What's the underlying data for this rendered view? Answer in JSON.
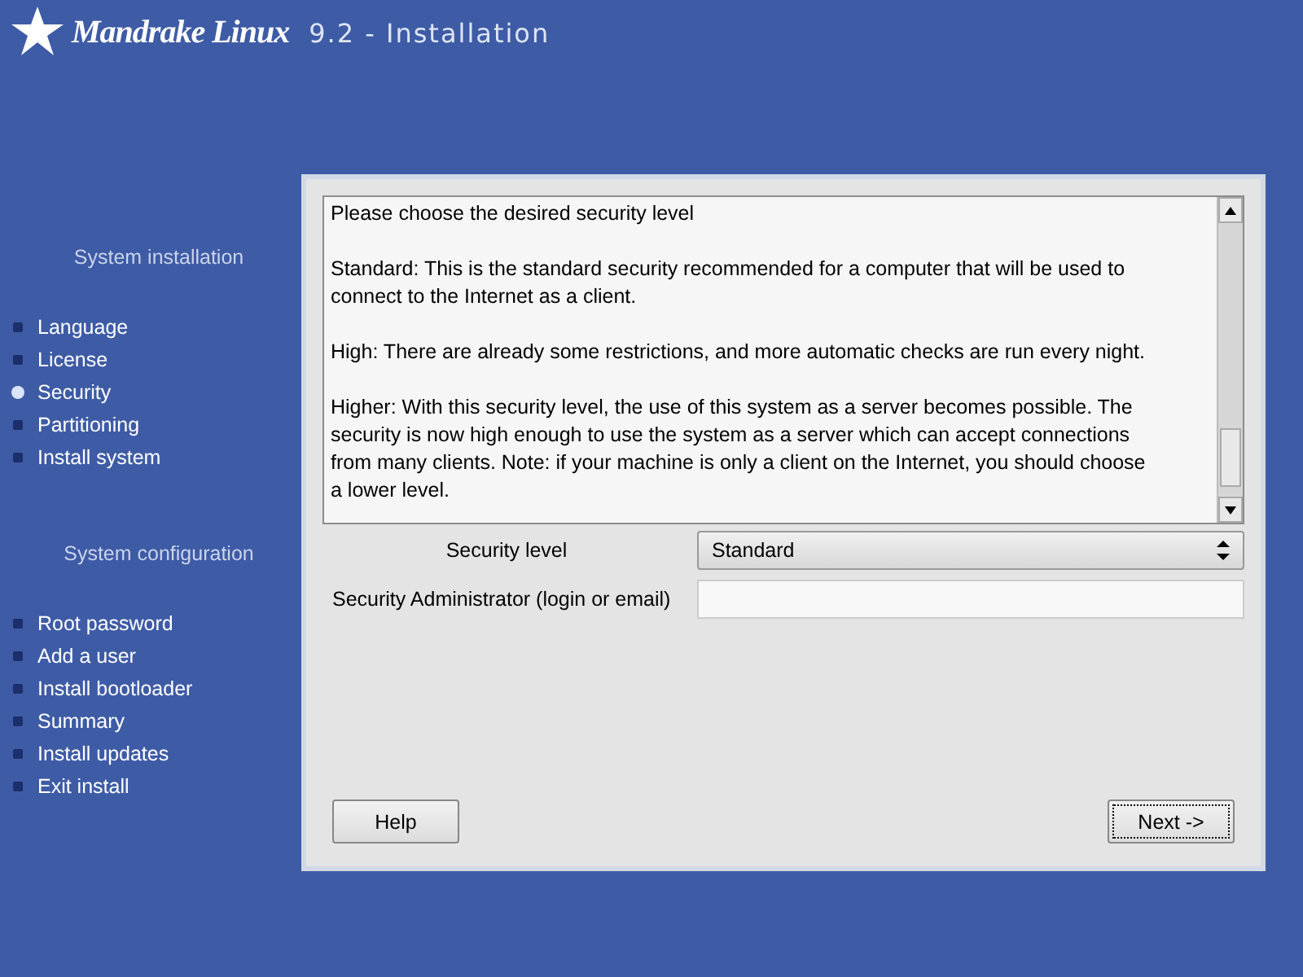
{
  "header": {
    "brand": "Mandrake Linux",
    "title": "9.2 - Installation"
  },
  "sidebar": {
    "sections": [
      {
        "heading": "System installation",
        "items": [
          {
            "label": "Language",
            "selected": false
          },
          {
            "label": "License",
            "selected": false
          },
          {
            "label": "Security",
            "selected": true
          },
          {
            "label": "Partitioning",
            "selected": false
          },
          {
            "label": "Install system",
            "selected": false
          }
        ]
      },
      {
        "heading": "System configuration",
        "items": [
          {
            "label": "Root password",
            "selected": false
          },
          {
            "label": "Add a user",
            "selected": false
          },
          {
            "label": "Install bootloader",
            "selected": false
          },
          {
            "label": "Summary",
            "selected": false
          },
          {
            "label": "Install updates",
            "selected": false
          },
          {
            "label": "Exit install",
            "selected": false
          }
        ]
      }
    ]
  },
  "dialog": {
    "paragraphs": [
      "Please choose the desired security level",
      "Standard: This is the standard security recommended for a computer that will be used to connect to the Internet as a client.",
      "High: There are already some restrictions, and more automatic checks are run every night.",
      "Higher: With this security level, the use of this system as a server becomes possible. The security is now high enough to use the system as a server which can accept connections from many clients. Note: if your machine is only a client on the Internet, you should choose a lower level."
    ],
    "fields": [
      {
        "kind": "select",
        "label": "Security level",
        "value": "Standard"
      },
      {
        "kind": "text",
        "label": "Security Administrator (login or email)"
      }
    ],
    "buttons": [
      {
        "label": "Help",
        "focused": false
      },
      {
        "label": "Next ->",
        "focused": true
      }
    ]
  }
}
